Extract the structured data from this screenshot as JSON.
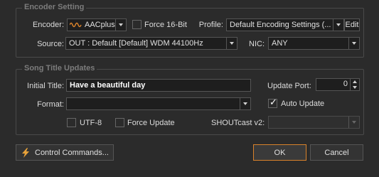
{
  "encoder_group": {
    "title": "Encoder Setting",
    "encoder_label": "Encoder:",
    "encoder_value": "AACplus",
    "force16_label": "Force 16-Bit",
    "profile_label": "Profile:",
    "profile_value": "Default Encoding Settings (...",
    "edit_label": "Edit",
    "source_label": "Source:",
    "source_value": "OUT  : Default [Default] WDM 44100Hz",
    "nic_label": "NIC:",
    "nic_value": "ANY"
  },
  "song_group": {
    "title": "Song Title Updates",
    "initial_title_label": "Initial Title:",
    "initial_title_value": "Have a beautiful day",
    "update_port_label": "Update Port:",
    "update_port_value": "0",
    "format_label": "Format:",
    "format_value": "",
    "auto_update_label": "Auto Update",
    "utf8_label": "UTF-8",
    "force_update_label": "Force Update",
    "shoutcast_label": "SHOUTcast v2:",
    "shoutcast_value": ""
  },
  "footer": {
    "control_commands_label": "Control Commands...",
    "ok_label": "OK",
    "cancel_label": "Cancel"
  },
  "state": {
    "force16": false,
    "auto_update": true,
    "utf8": false,
    "force_update": false
  },
  "icons": {
    "encoder": "waveform-icon",
    "control_commands": "lightning-icon"
  },
  "colors": {
    "accent": "#d9822b",
    "background": "#2b2b2b"
  }
}
